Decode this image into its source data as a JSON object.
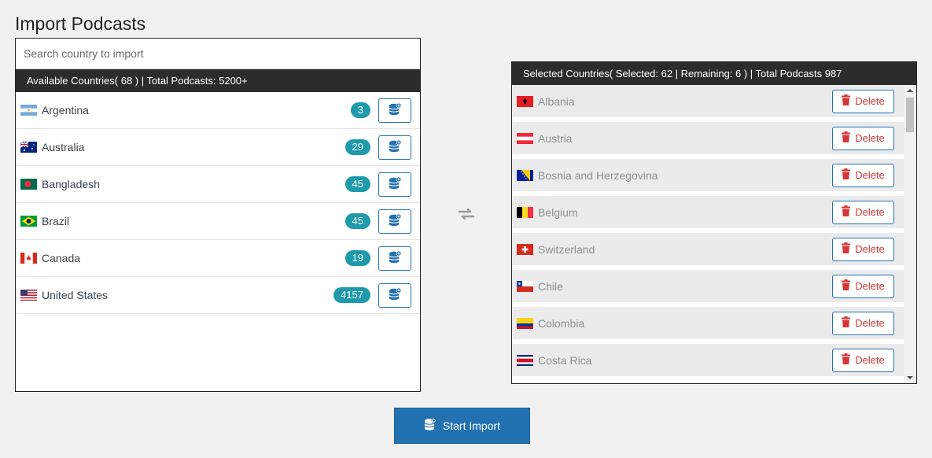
{
  "page": {
    "title": "Import Podcasts"
  },
  "search": {
    "placeholder": "Search country to import",
    "value": ""
  },
  "available": {
    "header": "Available Countries( 68 ) | Total Podcasts: 5200+",
    "items": [
      {
        "name": "Argentina",
        "count": "3",
        "flag": "argentina-flag-icon"
      },
      {
        "name": "Australia",
        "count": "29",
        "flag": "australia-flag-icon"
      },
      {
        "name": "Bangladesh",
        "count": "45",
        "flag": "bangladesh-flag-icon"
      },
      {
        "name": "Brazil",
        "count": "45",
        "flag": "brazil-flag-icon"
      },
      {
        "name": "Canada",
        "count": "19",
        "flag": "canada-flag-icon"
      },
      {
        "name": "United States",
        "count": "4157",
        "flag": "united-states-flag-icon"
      }
    ]
  },
  "selected": {
    "header": "Selected Countries( Selected: 62 | Remaining: 6 ) | Total Podcasts 987",
    "delete_label": "Delete",
    "items": [
      {
        "name": "Albania",
        "flag": "albania-flag-icon"
      },
      {
        "name": "Austria",
        "flag": "austria-flag-icon"
      },
      {
        "name": "Bosnia and Herzegovina",
        "flag": "bosnia-flag-icon"
      },
      {
        "name": "Belgium",
        "flag": "belgium-flag-icon"
      },
      {
        "name": "Switzerland",
        "flag": "switzerland-flag-icon"
      },
      {
        "name": "Chile",
        "flag": "chile-flag-icon"
      },
      {
        "name": "Colombia",
        "flag": "colombia-flag-icon"
      },
      {
        "name": "Costa Rica",
        "flag": "costa-rica-flag-icon"
      }
    ]
  },
  "actions": {
    "start_label": "Start Import"
  },
  "colors": {
    "accent": "#2271b1",
    "badge": "#1e9aab",
    "delete": "#d63638",
    "header_bg": "#2c2c2c"
  }
}
